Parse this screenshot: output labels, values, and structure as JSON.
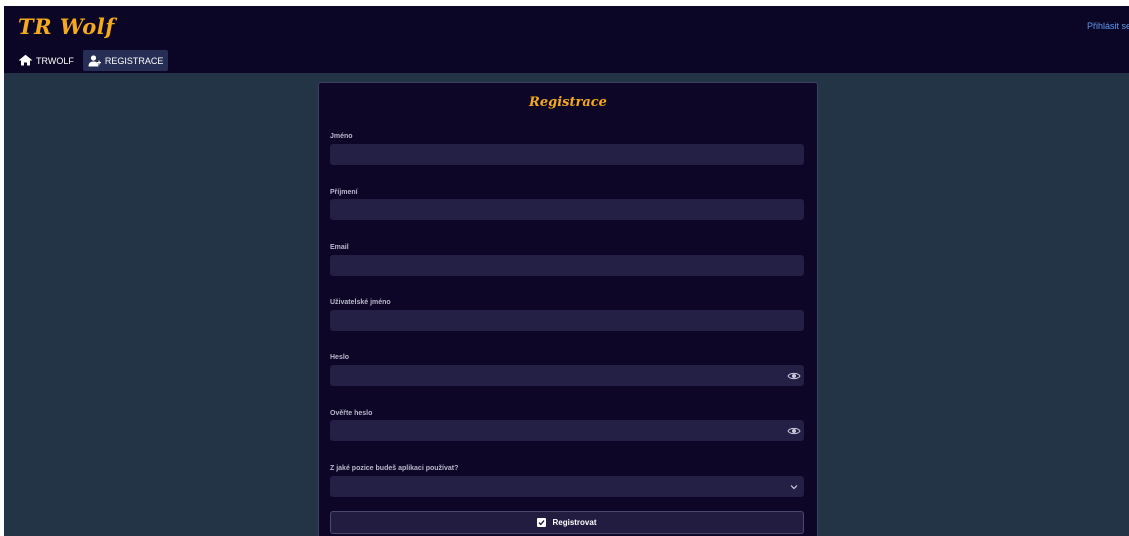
{
  "header": {
    "brand": "TR Wolf",
    "login_link": "Přihlásit se"
  },
  "nav": {
    "items": [
      {
        "label": "TRWOLF",
        "icon": "home-icon"
      },
      {
        "label": "REGISTRACE",
        "icon": "user-add-icon",
        "active": true
      }
    ]
  },
  "form": {
    "title": "Registrace",
    "fields": [
      {
        "label": "Jméno",
        "value": ""
      },
      {
        "label": "Příjmení",
        "value": ""
      },
      {
        "label": "Email",
        "value": ""
      },
      {
        "label": "Uživatelské jméno",
        "value": ""
      },
      {
        "label": "Heslo",
        "value": "",
        "icon": "eye-icon"
      },
      {
        "label": "Ověřte heslo",
        "value": "",
        "icon": "eye-icon"
      },
      {
        "label": "Z jaké pozice budeš aplikaci používat?",
        "value": "",
        "icon": "chevron-down-icon"
      }
    ],
    "submit_label": "Registrovat",
    "submit_icon": "checkbox-icon"
  },
  "colors": {
    "accent": "#f5a91f",
    "header_bg": "#0c0626",
    "page_bg": "#243447",
    "card_bg": "#0d0626",
    "input_bg": "#231f45",
    "link": "#5b9cf0"
  }
}
